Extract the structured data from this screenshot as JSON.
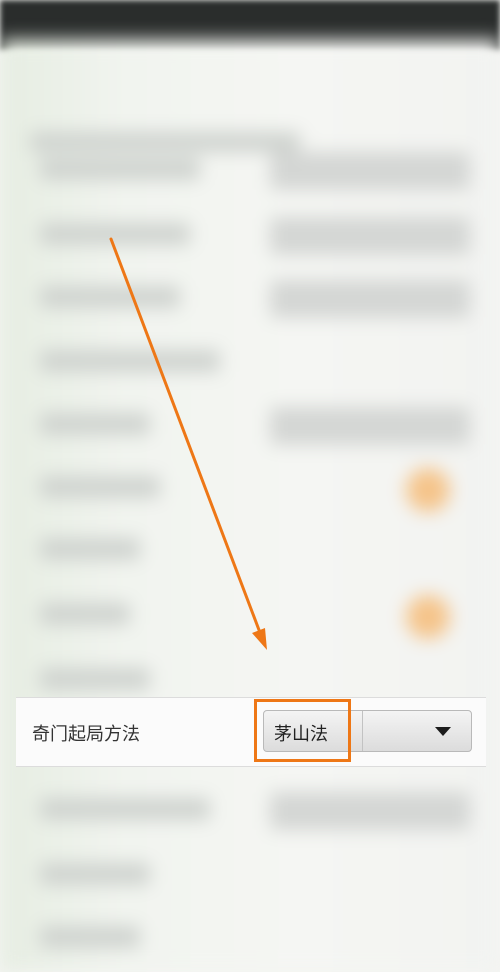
{
  "setting": {
    "label": "奇门起局方法",
    "selected_value": "茅山法"
  },
  "icons": {
    "dropdown": "chevron-down-icon",
    "annotation_arrow": "arrow-icon"
  },
  "colors": {
    "highlight": "#ee7716",
    "annotation_arrow": "#ee7716"
  }
}
